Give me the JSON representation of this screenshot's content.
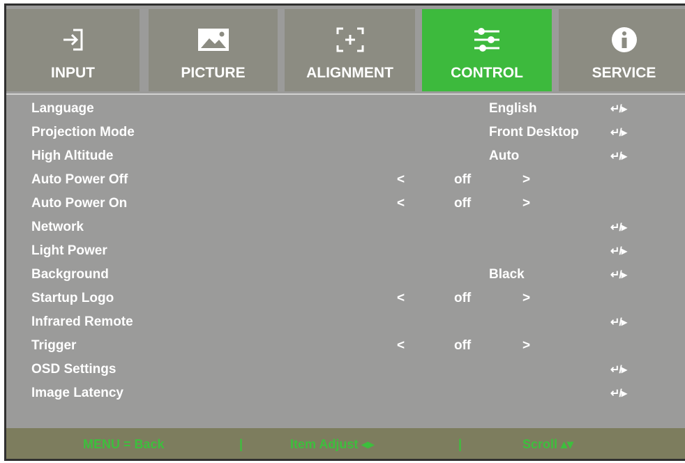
{
  "tabs": [
    {
      "label": "INPUT",
      "icon": "input-icon",
      "active": false
    },
    {
      "label": "PICTURE",
      "icon": "picture-icon",
      "active": false
    },
    {
      "label": "ALIGNMENT",
      "icon": "alignment-icon",
      "active": false
    },
    {
      "label": "CONTROL",
      "icon": "control-icon",
      "active": true
    },
    {
      "label": "SERVICE",
      "icon": "service-icon",
      "active": false
    }
  ],
  "items": [
    {
      "name": "Language",
      "option": "English",
      "enter": "↵/▸"
    },
    {
      "name": "Projection Mode",
      "option": "Front Desktop",
      "enter": "↵/▸"
    },
    {
      "name": "High Altitude",
      "option": "Auto",
      "enter": "↵/▸"
    },
    {
      "name": "Auto Power Off",
      "left": "<",
      "value": "off",
      "right": ">"
    },
    {
      "name": "Auto Power On",
      "left": "<",
      "value": "off",
      "right": ">"
    },
    {
      "name": "Network",
      "enter": "↵/▸"
    },
    {
      "name": "Light Power",
      "enter": "↵/▸"
    },
    {
      "name": "Background",
      "option": "Black",
      "enter": "↵/▸"
    },
    {
      "name": "Startup Logo",
      "left": "<",
      "value": "off",
      "right": ">"
    },
    {
      "name": "Infrared Remote",
      "enter": "↵/▸"
    },
    {
      "name": "Trigger",
      "left": "<",
      "value": "off",
      "right": ">"
    },
    {
      "name": "OSD Settings",
      "enter": "↵/▸"
    },
    {
      "name": "Image Latency",
      "enter": "↵/▸"
    }
  ],
  "footer": {
    "back": "MENU = Back",
    "sep1": "|",
    "item_adjust": "Item  Adjust  ◂▸",
    "sep2": "|",
    "scroll": "Scroll  ▴▾"
  },
  "colors": {
    "active_tab": "#3dba3d",
    "tab": "#8c8c82",
    "panel": "#9b9b9a",
    "footer": "#7d7d5e",
    "footer_text": "#3dbf3d"
  }
}
